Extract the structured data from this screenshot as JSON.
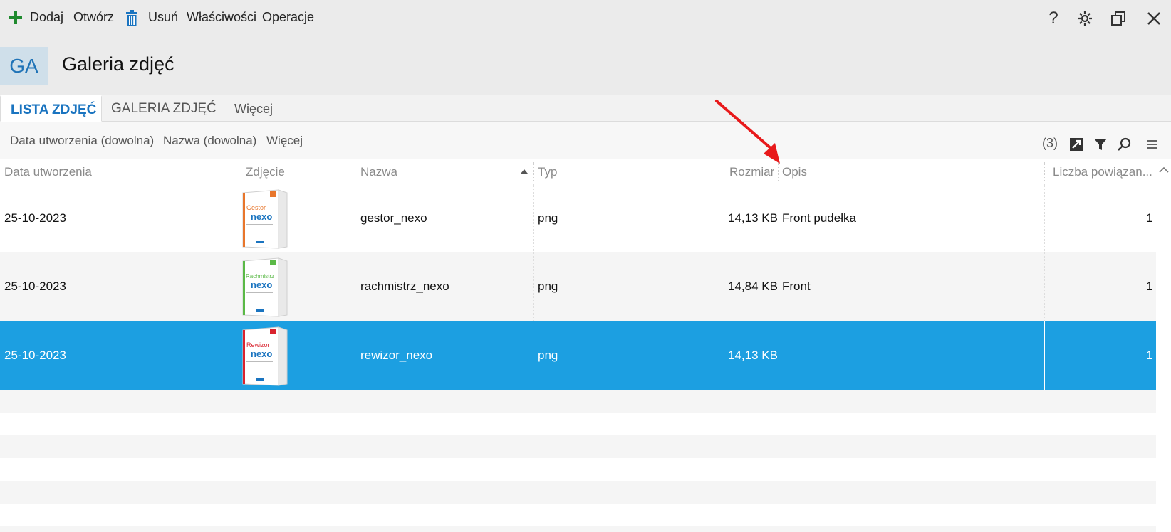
{
  "toolbar": {
    "add_label": "Dodaj",
    "open_label": "Otwórz",
    "delete_label": "Usuń",
    "properties_label": "Właściwości",
    "operations_label": "Operacje"
  },
  "window_controls": {
    "help_glyph": "?"
  },
  "header": {
    "badge": "GA",
    "title": "Galeria zdjęć"
  },
  "tabs": [
    {
      "label": "LISTA ZDJĘĆ",
      "active": true
    },
    {
      "label": "GALERIA ZDJĘĆ",
      "active": false
    },
    {
      "label": "Więcej",
      "active": false
    }
  ],
  "filters": {
    "items": [
      "Data utworzenia (dowolna)",
      "Nazwa (dowolna)",
      "Więcej"
    ],
    "count": "(3)"
  },
  "columns": [
    "Data utworzenia",
    "Zdjęcie",
    "Nazwa",
    "Typ",
    "Rozmiar",
    "Opis",
    "Liczba powiązan..."
  ],
  "rows": [
    {
      "date": "25-10-2023",
      "image": {
        "brand": "Gestor",
        "logo": "nexo",
        "color": "#e8762c"
      },
      "name": "gestor_nexo",
      "type": "png",
      "size": "14,13 KB",
      "desc": "Front pudełka",
      "links": "1",
      "selected": false
    },
    {
      "date": "25-10-2023",
      "image": {
        "brand": "Rachmistrz",
        "logo": "nexo",
        "color": "#5bb947"
      },
      "name": "rachmistrz_nexo",
      "type": "png",
      "size": "14,84 KB",
      "desc": "Front",
      "links": "1",
      "selected": false
    },
    {
      "date": "25-10-2023",
      "image": {
        "brand": "Rewizor",
        "logo": "nexo",
        "color": "#d9232e"
      },
      "name": "rewizor_nexo",
      "type": "png",
      "size": "14,13 KB",
      "desc": "",
      "links": "1",
      "selected": true
    }
  ],
  "colors": {
    "accent": "#1a74c0",
    "selection": "#1c9fe1",
    "annotation_arrow": "#e8191b"
  }
}
